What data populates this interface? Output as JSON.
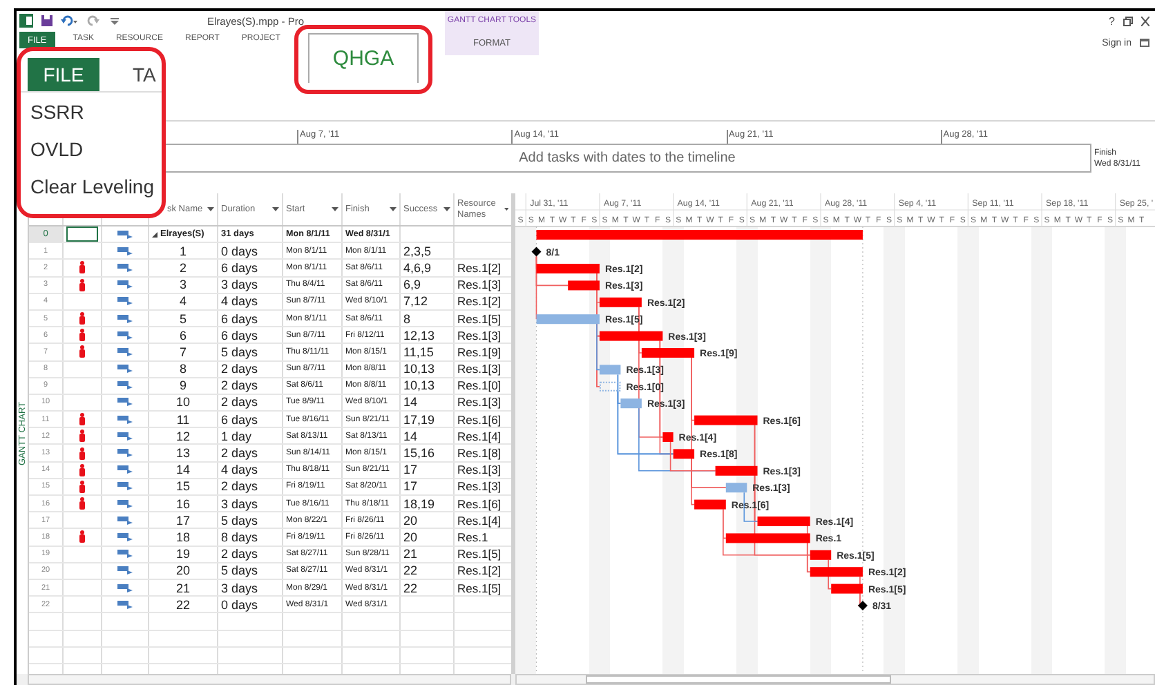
{
  "title_bar": {
    "document_title": "Elrayes(S).mpp - Pro",
    "help": "?"
  },
  "contextual_group": {
    "title": "GANTT CHART TOOLS",
    "tab": "FORMAT"
  },
  "ribbon_tabs": [
    {
      "label": "FILE",
      "kind": "file",
      "selected": false
    },
    {
      "label": "TASK",
      "kind": "tab",
      "selected": false
    },
    {
      "label": "RESOURCE",
      "kind": "tab",
      "selected": false
    },
    {
      "label": "REPORT",
      "kind": "tab",
      "selected": false
    },
    {
      "label": "PROJECT",
      "kind": "tab",
      "selected": false
    },
    {
      "label": "QHGA",
      "kind": "custom",
      "selected": true
    }
  ],
  "sign_in": "Sign in",
  "callout": {
    "file_tab": "FILE",
    "next_tab": "TA",
    "commands": [
      "SSRR",
      "OVLD",
      "Clear Leveling"
    ]
  },
  "timeline": {
    "dates": [
      "Aug 7, '11",
      "Aug 14, '11",
      "Aug 21, '11",
      "Aug 28, '11"
    ],
    "message": "Add tasks with dates to the timeline",
    "finish_label": "Finish",
    "finish_date": "Wed 8/31/11"
  },
  "view_label": "GANTT CHART",
  "table": {
    "columns": [
      "sk Name",
      "Duration",
      "Start",
      "Finish",
      "Success",
      "Resource Names"
    ],
    "summary": {
      "id": "0",
      "name": "Elrayes(S)",
      "duration": "31 days",
      "start": "Mon 8/1/11",
      "finish": "Wed 8/31/1"
    },
    "rows": [
      {
        "id": "1",
        "indicator": false,
        "name": "1",
        "duration": "0 days",
        "start": "Mon 8/1/11",
        "finish": "Mon 8/1/11",
        "successors": "2,3,5",
        "bar": {
          "kind": "milestone",
          "label": "8/1",
          "color": "#000000"
        }
      },
      {
        "id": "2",
        "indicator": true,
        "name": "2",
        "duration": "6 days",
        "start": "Mon 8/1/11",
        "finish": "Sat 8/6/11",
        "successors": "4,6,9",
        "resources": "Res.1[2]",
        "bar": {
          "kind": "task",
          "label": "Res.1[2]",
          "color": "#ff0000"
        }
      },
      {
        "id": "3",
        "indicator": true,
        "name": "3",
        "duration": "3 days",
        "start": "Thu 8/4/11",
        "finish": "Sat 8/6/11",
        "successors": "6,9",
        "resources": "Res.1[3]",
        "bar": {
          "kind": "task",
          "label": "Res.1[3]",
          "color": "#ff0000"
        }
      },
      {
        "id": "4",
        "indicator": false,
        "name": "4",
        "duration": "4 days",
        "start": "Sun 8/7/11",
        "finish": "Wed 8/10/1",
        "successors": "7,12",
        "resources": "Res.1[2]",
        "bar": {
          "kind": "task",
          "label": "Res.1[2]",
          "color": "#ff0000"
        }
      },
      {
        "id": "5",
        "indicator": true,
        "name": "5",
        "duration": "6 days",
        "start": "Mon 8/1/11",
        "finish": "Sat 8/6/11",
        "successors": "8",
        "resources": "Res.1[5]",
        "bar": {
          "kind": "task",
          "label": "Res.1[5]",
          "color": "#8db4e2"
        }
      },
      {
        "id": "6",
        "indicator": true,
        "name": "6",
        "duration": "6 days",
        "start": "Sun 8/7/11",
        "finish": "Fri 8/12/11",
        "successors": "12,13",
        "resources": "Res.1[3]",
        "bar": {
          "kind": "task",
          "label": "Res.1[3]",
          "color": "#ff0000"
        }
      },
      {
        "id": "7",
        "indicator": true,
        "name": "7",
        "duration": "5 days",
        "start": "Thu 8/11/11",
        "finish": "Mon 8/15/1",
        "successors": "11,15",
        "resources": "Res.1[9]",
        "bar": {
          "kind": "task",
          "label": "Res.1[9]",
          "color": "#ff0000"
        }
      },
      {
        "id": "8",
        "indicator": false,
        "name": "8",
        "duration": "2 days",
        "start": "Sun 8/7/11",
        "finish": "Mon 8/8/11",
        "successors": "10,13",
        "resources": "Res.1[3]",
        "bar": {
          "kind": "task",
          "label": "Res.1[3]",
          "color": "#8db4e2"
        }
      },
      {
        "id": "9",
        "indicator": false,
        "name": "9",
        "duration": "2 days",
        "start": "Sat 8/6/11",
        "finish": "Mon 8/8/11",
        "successors": "10,13",
        "resources": "Res.1[0]",
        "bar": {
          "kind": "placeholder",
          "label": "Res.1[0]",
          "color": "#8db4e2"
        }
      },
      {
        "id": "10",
        "indicator": false,
        "name": "10",
        "duration": "2 days",
        "start": "Tue 8/9/11",
        "finish": "Wed 8/10/1",
        "successors": "14",
        "resources": "Res.1[3]",
        "bar": {
          "kind": "task",
          "label": "Res.1[3]",
          "color": "#8db4e2"
        }
      },
      {
        "id": "11",
        "indicator": true,
        "name": "11",
        "duration": "6 days",
        "start": "Tue 8/16/11",
        "finish": "Sun 8/21/11",
        "successors": "17,19",
        "resources": "Res.1[6]",
        "bar": {
          "kind": "task",
          "label": "Res.1[6]",
          "color": "#ff0000"
        }
      },
      {
        "id": "12",
        "indicator": true,
        "name": "12",
        "duration": "1 day",
        "start": "Sat 8/13/11",
        "finish": "Sat 8/13/11",
        "successors": "14",
        "resources": "Res.1[4]",
        "bar": {
          "kind": "task",
          "label": "Res.1[4]",
          "color": "#ff0000"
        }
      },
      {
        "id": "13",
        "indicator": true,
        "name": "13",
        "duration": "2 days",
        "start": "Sun 8/14/11",
        "finish": "Mon 8/15/1",
        "successors": "15,16",
        "resources": "Res.1[8]",
        "bar": {
          "kind": "task",
          "label": "Res.1[8]",
          "color": "#ff0000"
        }
      },
      {
        "id": "14",
        "indicator": true,
        "name": "14",
        "duration": "4 days",
        "start": "Thu 8/18/11",
        "finish": "Sun 8/21/11",
        "successors": "17",
        "resources": "Res.1[3]",
        "bar": {
          "kind": "task",
          "label": "Res.1[3]",
          "color": "#ff0000"
        }
      },
      {
        "id": "15",
        "indicator": true,
        "name": "15",
        "duration": "2 days",
        "start": "Fri 8/19/11",
        "finish": "Sat 8/20/11",
        "successors": "17",
        "resources": "Res.1[3]",
        "bar": {
          "kind": "task",
          "label": "Res.1[3]",
          "color": "#8db4e2"
        }
      },
      {
        "id": "16",
        "indicator": true,
        "name": "16",
        "duration": "3 days",
        "start": "Tue 8/16/11",
        "finish": "Thu 8/18/11",
        "successors": "18,19",
        "resources": "Res.1[6]",
        "bar": {
          "kind": "task",
          "label": "Res.1[6]",
          "color": "#ff0000"
        }
      },
      {
        "id": "17",
        "indicator": false,
        "name": "17",
        "duration": "5 days",
        "start": "Mon 8/22/1",
        "finish": "Fri 8/26/11",
        "successors": "20",
        "resources": "Res.1[4]",
        "bar": {
          "kind": "task",
          "label": "Res.1[4]",
          "color": "#ff0000"
        }
      },
      {
        "id": "18",
        "indicator": true,
        "name": "18",
        "duration": "8 days",
        "start": "Fri 8/19/11",
        "finish": "Fri 8/26/11",
        "successors": "20",
        "resources": "Res.1",
        "bar": {
          "kind": "task",
          "label": "Res.1",
          "color": "#ff0000"
        }
      },
      {
        "id": "19",
        "indicator": false,
        "name": "19",
        "duration": "2 days",
        "start": "Sat 8/27/11",
        "finish": "Sun 8/28/11",
        "successors": "21",
        "resources": "Res.1[5]",
        "bar": {
          "kind": "task",
          "label": "Res.1[5]",
          "color": "#ff0000"
        }
      },
      {
        "id": "20",
        "indicator": false,
        "name": "20",
        "duration": "5 days",
        "start": "Sat 8/27/11",
        "finish": "Wed 8/31/1",
        "successors": "22",
        "resources": "Res.1[2]",
        "bar": {
          "kind": "task",
          "label": "Res.1[2]",
          "color": "#ff0000"
        }
      },
      {
        "id": "21",
        "indicator": false,
        "name": "21",
        "duration": "3 days",
        "start": "Mon 8/29/1",
        "finish": "Wed 8/31/1",
        "successors": "22",
        "resources": "Res.1[5]",
        "bar": {
          "kind": "task",
          "label": "Res.1[5]",
          "color": "#ff0000"
        }
      },
      {
        "id": "22",
        "indicator": false,
        "name": "22",
        "duration": "0 days",
        "start": "Wed 8/31/1",
        "finish": "Wed 8/31/1",
        "bar": {
          "kind": "milestone",
          "label": "8/31",
          "color": "#000000"
        }
      }
    ]
  },
  "gantt": {
    "timescale": {
      "lead_days": [
        "S"
      ],
      "weeks": [
        {
          "label": "Jul 31, '11",
          "days": [
            "S",
            "M",
            "T",
            "W",
            "T",
            "F",
            "S"
          ]
        },
        {
          "label": "Aug 7, '11",
          "days": [
            "S",
            "M",
            "T",
            "W",
            "T",
            "F",
            "S"
          ]
        },
        {
          "label": "Aug 14, '11",
          "days": [
            "S",
            "M",
            "T",
            "W",
            "T",
            "F",
            "S"
          ]
        },
        {
          "label": "Aug 21, '11",
          "days": [
            "S",
            "M",
            "T",
            "W",
            "T",
            "F",
            "S"
          ]
        },
        {
          "label": "Aug 28, '11",
          "days": [
            "S",
            "M",
            "T",
            "W",
            "T",
            "F",
            "S"
          ]
        },
        {
          "label": "Sep 4, '11",
          "days": [
            "S",
            "M",
            "T",
            "W",
            "T",
            "F",
            "S"
          ]
        },
        {
          "label": "Sep 11, '11",
          "days": [
            "S",
            "M",
            "T",
            "W",
            "T",
            "F",
            "S"
          ]
        },
        {
          "label": "Sep 18, '11",
          "days": [
            "S",
            "M",
            "T",
            "W",
            "T",
            "F",
            "S"
          ]
        },
        {
          "label": "Sep 25, '",
          "days": [
            "S",
            "M",
            "T"
          ]
        }
      ]
    }
  }
}
